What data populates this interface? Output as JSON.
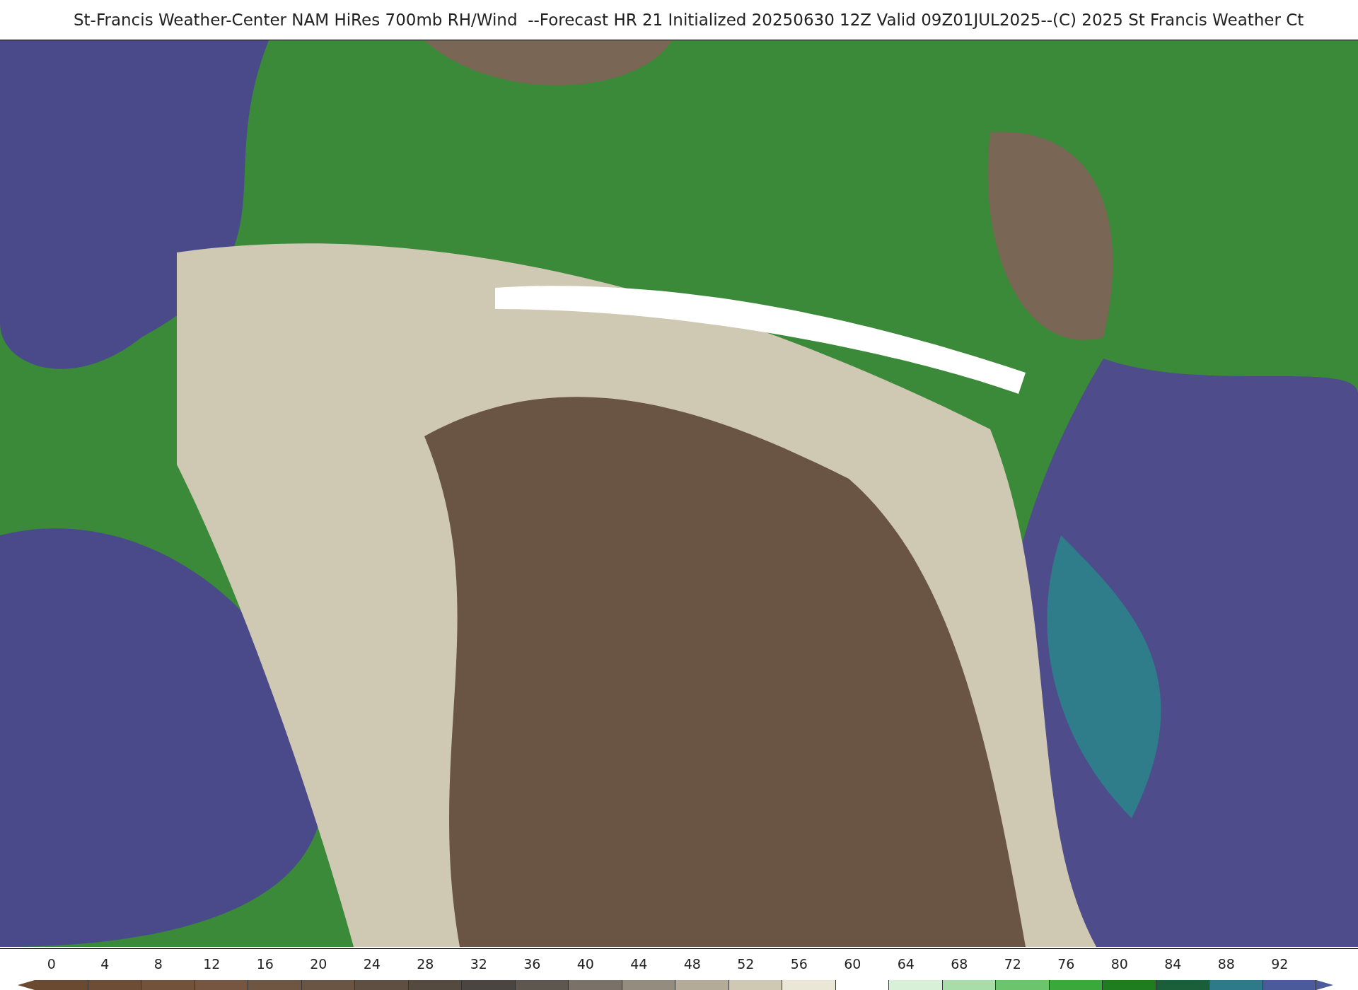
{
  "title": "St-Francis Weather-Center NAM HiRes 700mb RH/Wind  --Forecast HR 21 Initialized 20250630 12Z Valid 09Z01JUL2025--(C) 2025 St Francis Weather Ct",
  "colorbar": [
    {
      "label": "0",
      "color": "#6b4a32"
    },
    {
      "label": "4",
      "color": "#6e4d36"
    },
    {
      "label": "8",
      "color": "#72523b"
    },
    {
      "label": "12",
      "color": "#765640"
    },
    {
      "label": "16",
      "color": "#6f5642"
    },
    {
      "label": "20",
      "color": "#6a5544"
    },
    {
      "label": "24",
      "color": "#5e4f42"
    },
    {
      "label": "28",
      "color": "#544a40"
    },
    {
      "label": "32",
      "color": "#4a4540"
    },
    {
      "label": "36",
      "color": "#5e5750"
    },
    {
      "label": "40",
      "color": "#7a7168"
    },
    {
      "label": "44",
      "color": "#958c80"
    },
    {
      "label": "48",
      "color": "#b3aa98"
    },
    {
      "label": "52",
      "color": "#cfc8b2"
    },
    {
      "label": "56",
      "color": "#ebe7d6"
    },
    {
      "label": "60",
      "color": "#ffffff"
    },
    {
      "label": "64",
      "color": "#d8f0d8"
    },
    {
      "label": "68",
      "color": "#a8dca8"
    },
    {
      "label": "72",
      "color": "#6cc46c"
    },
    {
      "label": "76",
      "color": "#3aa83a"
    },
    {
      "label": "80",
      "color": "#1f7d1f"
    },
    {
      "label": "84",
      "color": "#1a5e3a"
    },
    {
      "label": "88",
      "color": "#2e7a8a"
    },
    {
      "label": "92",
      "color": "#4a5a9a"
    }
  ]
}
